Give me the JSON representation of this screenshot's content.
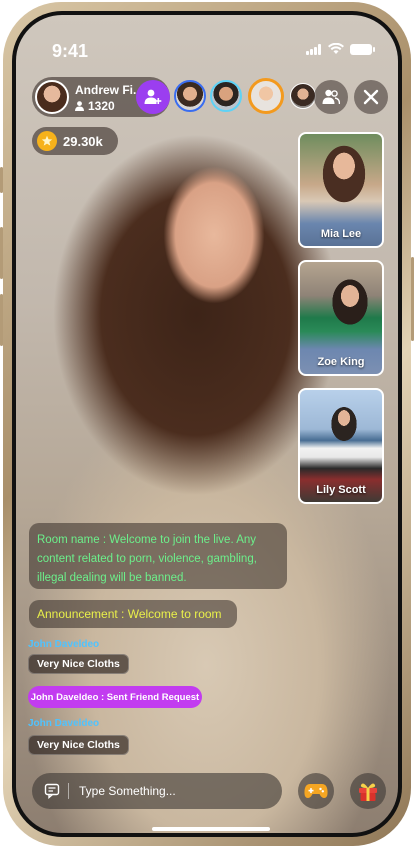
{
  "status": {
    "time": "9:41"
  },
  "host": {
    "name": "Andrew Fi..",
    "followers": "1320"
  },
  "coins": {
    "value": "29.30k"
  },
  "guests": [
    {
      "name": "Mia Lee"
    },
    {
      "name": "Zoe King"
    },
    {
      "name": "Lily Scott"
    }
  ],
  "room_message": "Room name : Welcome to join the live. Any content related to porn, violence, gambling, illegal dealing will be banned.",
  "announcement": "Announcement : Welcome to room",
  "chat": [
    {
      "user": "John Daveldeo",
      "text": "Very Nice Cloths"
    },
    {
      "user": "John Daveldeo",
      "text": "Very Nice Cloths"
    }
  ],
  "friend_request": "John Daveldeo : Sent Friend Request",
  "input": {
    "placeholder": "Type Something..."
  },
  "colors": {
    "accent_purple": "#9b3ef0",
    "room_text": "#6cf08b",
    "announcement_text": "#e9f04a",
    "username_blue": "#4fc3ff",
    "friend_request_bg": "#c23cf0"
  },
  "icons": [
    "signal-icon",
    "wifi-icon",
    "battery-icon",
    "user-icon",
    "add-user-icon",
    "users-icon",
    "close-icon",
    "star-coin-icon",
    "chat-icon",
    "gamepad-icon",
    "gift-icon"
  ]
}
